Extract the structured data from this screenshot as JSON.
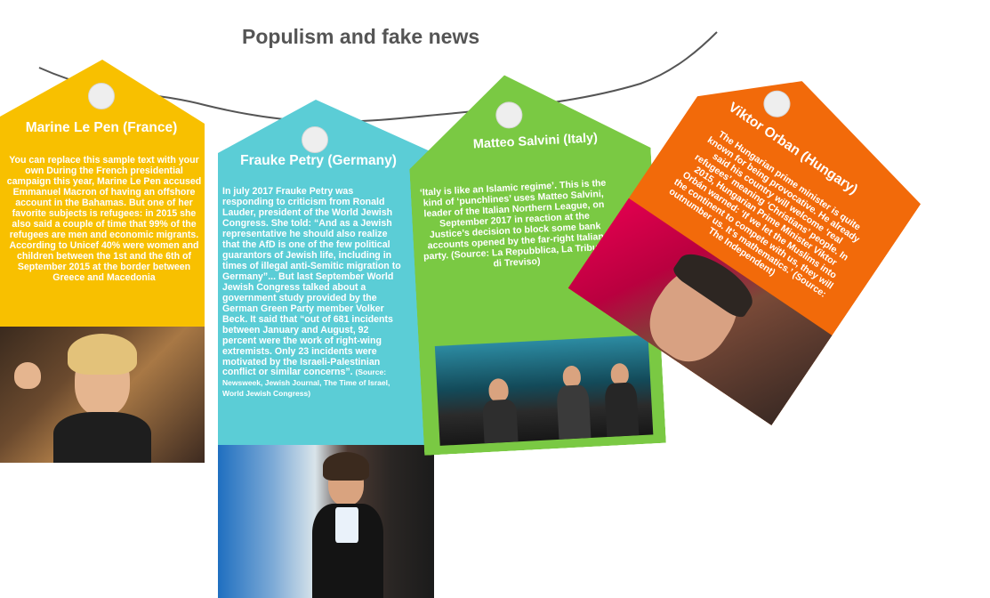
{
  "title": "Populism and fake news",
  "colors": {
    "title": "#555555",
    "lepen": "#f8c000",
    "petry": "#5bcdd6",
    "salvini": "#7ac943",
    "orban": "#f26a0a",
    "string": "#555555"
  },
  "tags": {
    "lepen": {
      "name": "Marine Le Pen (France)",
      "text": "You can replace this sample text with your own During the French presidential campaign this year, Marine Le Pen accused Emmanuel Macron of having an offshore account in the Bahamas. But one of her favorite subjects is refugees: in 2015 she also said a couple of time that 99% of the refugees are men and economic migrants.",
      "text2": "According to Unicef 40% were women and children between the 1st and the 6th of September 2015 at the border between Greece and Macedonia",
      "photo": "Marine Le Pen photo"
    },
    "petry": {
      "name": "Frauke Petry (Germany)",
      "text": "In july 2017 Frauke Petry was responding to criticism from Ronald Lauder, president of the World Jewish Congress. She told: “And as a Jewish representative he should also realize that the AfD is one of the few political guarantors of Jewish life, including in times of illegal anti-Semitic migration to Germany”... But last September World Jewish Congress talked about a government study provided by the German Green Party member Volker Beck. It said that “out of 681 incidents between January and August, 92 percent were the work of right-wing extremists. Only 23 incidents were motivated by the Israeli-Palestinian conflict or similar concerns”.",
      "source": "(Source: Newsweek, Jewish Journal, The Time of Israel, World Jewish Congress)",
      "photo": "Frauke Petry photo"
    },
    "salvini": {
      "name": "Matteo Salvini (Italy)",
      "text": "‘Italy is like an Islamic regime’. This is the kind of ‘punchlines’ uses Matteo Salvini, leader of the Italian Northern League, on September 2017 in reaction at the Justice’s decision to block some bank accounts opened by the far-right Italian party. (Source: La Repubblica, La Tribuna di Treviso)",
      "photo": "Matteo Salvini photo"
    },
    "orban": {
      "name": "Viktor Orban (Hungary)",
      "text": "The Hungarian prime minister is quite known for being provocative. He already said his country will welcome ‘real refugees’ meaning ‘Christians’ people. In 2015, Hungarian Prime Minister Viktor Orbán warned: ‘If we let the Muslims into the continent to compete with us, they will outnumber us. It’s mathematics.’ (Source: The Independent)",
      "photo": "Viktor Orban photo"
    }
  }
}
